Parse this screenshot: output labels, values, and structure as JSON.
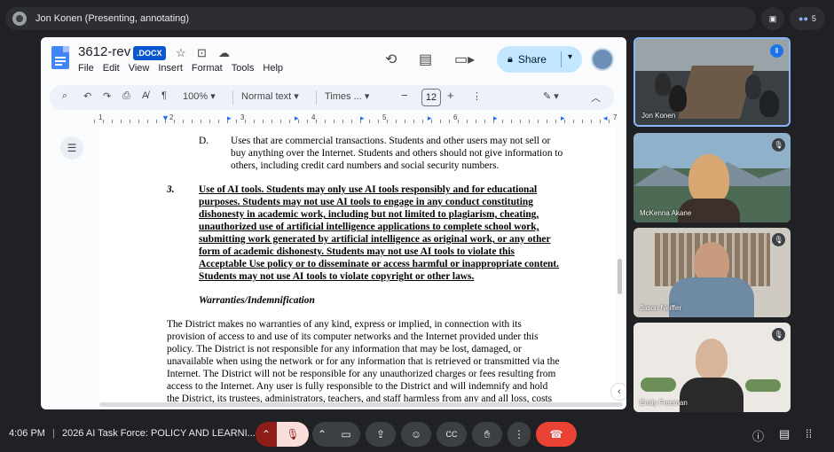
{
  "meeting": {
    "presenter_title": "Jon Konen (Presenting, annotating)",
    "participant_count": "5",
    "time": "4:06 PM",
    "meeting_name": "2026 AI Task Force: POLICY AND LEARNI..."
  },
  "doc": {
    "name": "3612-rev",
    "badge": ".DOCX",
    "menu": [
      "File",
      "Edit",
      "View",
      "Insert",
      "Format",
      "Tools",
      "Help"
    ],
    "share_label": "Share",
    "zoom": "100%",
    "style": "Normal text",
    "font": "Times ...",
    "font_size": "12",
    "minus": "−",
    "plus": "+"
  },
  "content": {
    "d_label": "D.",
    "d_lines": [
      "Uses that are commercial transactions. Students and other users may not sell or",
      "buy anything over the Internet. Students and others should not give information to",
      "others, including credit card numbers and social security numbers."
    ],
    "item3_label": "3.",
    "item3_lines": [
      "Use of AI tools.  Students may only use AI tools responsibly and for educational",
      "purposes.  Students may not use AI tools to engage in any conduct constituting",
      "dishonesty in academic work, including but not limited to plagiarism, cheating,",
      "unauthorized use of artificial intelligence applications to complete school work,",
      "submitting work generated by artificial intelligence as original work, or any other",
      "form of academic dishonesty.  Students may not use AI tools to violate this",
      "Acceptable Use policy or to disseminate or access harmful or inappropriate content.",
      "Students may not use AI tools to violate copyright or other laws."
    ],
    "heading": "Warranties/Indemnification",
    "para_lines": [
      "The District makes no warranties of any kind, express or implied, in connection with its",
      "provision of access to and use of its computer networks and the Internet provided under this",
      "policy. The District is not responsible for any information that may be lost, damaged, or",
      "unavailable when using the network or for any information that is retrieved or transmitted via the",
      "Internet. The District will not be responsible for any unauthorized charges or fees resulting from",
      "access to the Internet. Any user is fully responsible to the District and will indemnify and hold",
      "the District, its trustees, administrators, teachers, and staff harmless from any and all loss, costs"
    ]
  },
  "ruler_numbers": [
    "1",
    "2",
    "3",
    "4",
    "5",
    "6",
    "7"
  ],
  "participants": [
    {
      "name": "Jon Konen"
    },
    {
      "name": "McKenna Akane"
    },
    {
      "name": "Jason Neiffer"
    },
    {
      "name": "Emily Freeman"
    }
  ],
  "colors": {
    "meet_bg": "#202124",
    "end_call": "#ea4335",
    "share_bg": "#c2e7ff",
    "docx_badge": "#0b57d0",
    "active_speaker": "#8ab4f8"
  }
}
